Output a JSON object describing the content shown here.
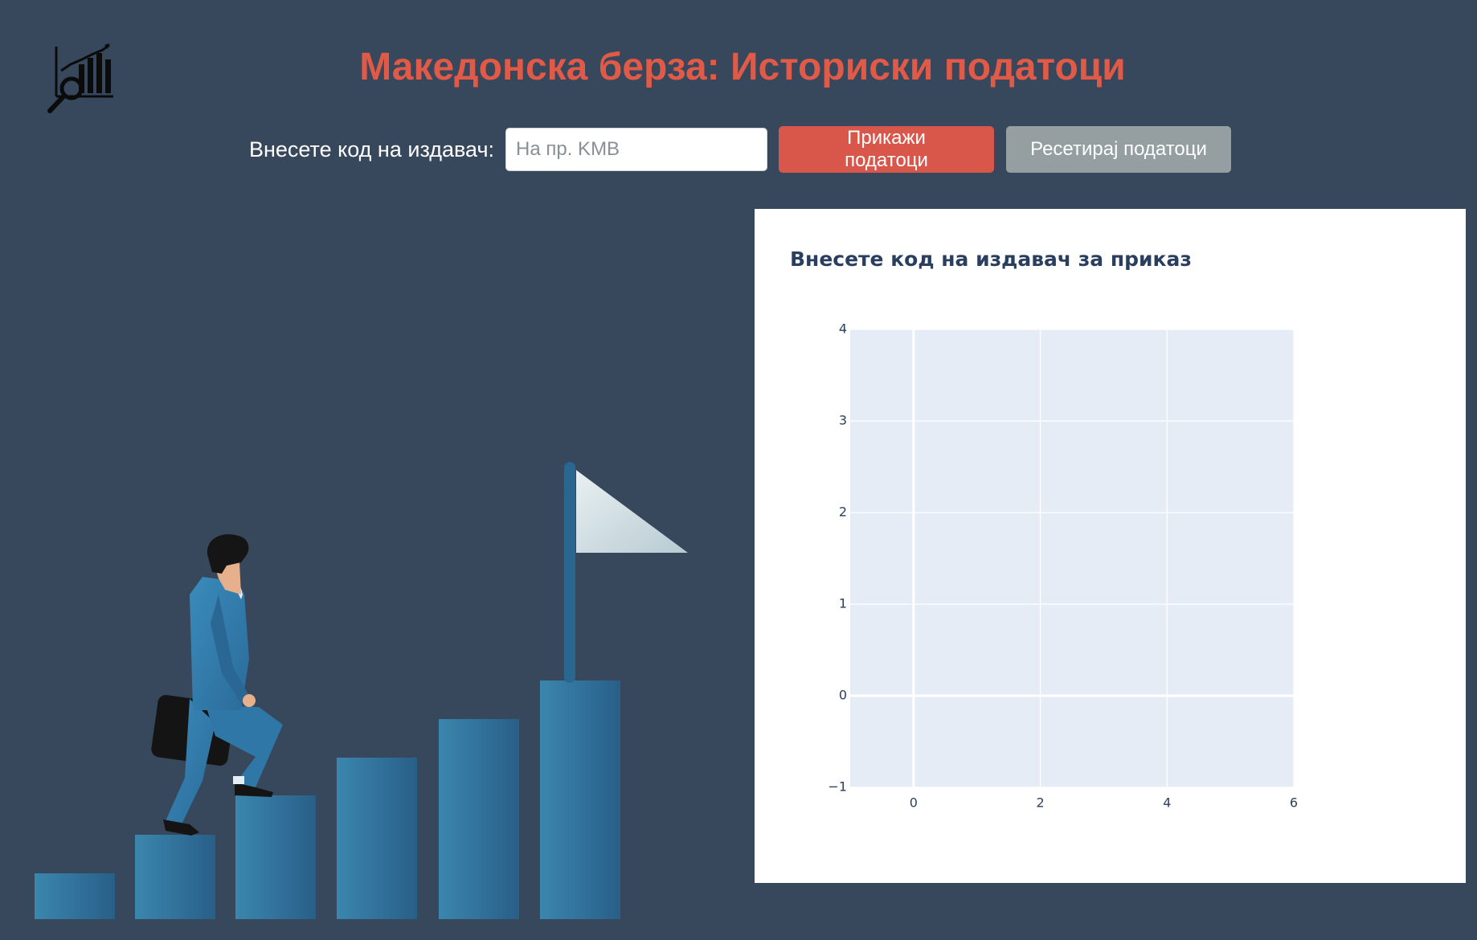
{
  "header": {
    "title": "Македонска берза: Историски податоци",
    "logo_icon": "chart-magnifier-icon"
  },
  "controls": {
    "issuer_label": "Внесете код на издавач:",
    "issuer_input_placeholder": "На пр. KMB",
    "issuer_input_value": "",
    "show_button_label": "Прикажи податоци",
    "reset_button_label": "Ресетирај податоци"
  },
  "colors": {
    "background": "#37475c",
    "title": "#e05a47",
    "show_button": "#d8574a",
    "reset_button": "#959fa2",
    "plot_background": "#e5ecf6"
  },
  "illustration": {
    "icon": "businessman-climbing-bar-stairs-to-flag-icon"
  },
  "chart_data": {
    "type": "line",
    "title": "Внесете код на издавач за приказ",
    "series": [],
    "x_ticks": [
      0,
      2,
      4,
      6
    ],
    "y_ticks": [
      -1,
      0,
      1,
      2,
      3,
      4
    ],
    "xlim": [
      -1,
      6
    ],
    "ylim": [
      -1,
      4
    ],
    "grid": true
  }
}
